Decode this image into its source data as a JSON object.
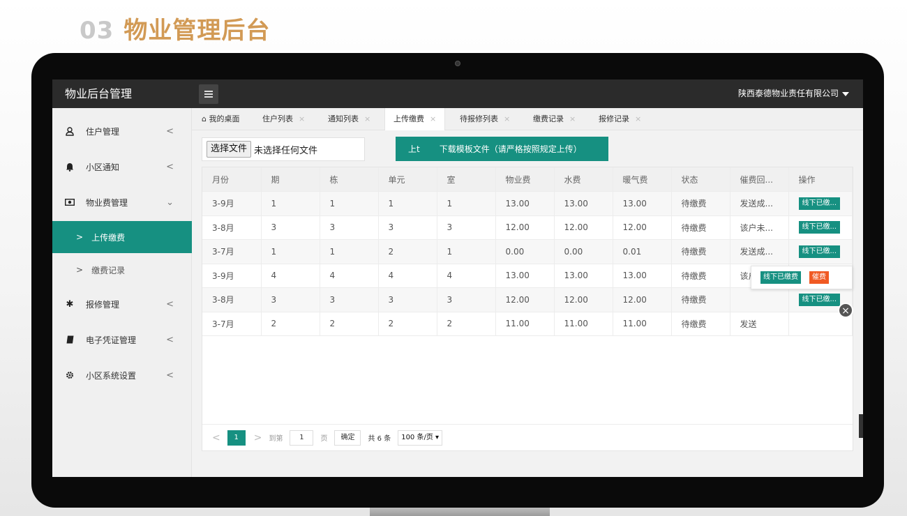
{
  "slide": {
    "number": "03",
    "title": "物业管理后台"
  },
  "app": {
    "brand": "物业后台管理",
    "company": "陕西泰德物业责任有限公司"
  },
  "sidebar": {
    "items": [
      {
        "label": "住户管理",
        "icon": "user-icon"
      },
      {
        "label": "小区通知",
        "icon": "bell-icon"
      },
      {
        "label": "物业费管理",
        "icon": "money-icon"
      },
      {
        "label": "报修管理",
        "icon": "wrench-icon"
      },
      {
        "label": "电子凭证管理",
        "icon": "book-icon"
      },
      {
        "label": "小区系统设置",
        "icon": "gear-icon"
      }
    ],
    "sub_items": [
      {
        "label": "上传缴费",
        "active": true
      },
      {
        "label": "缴费记录",
        "active": false
      }
    ]
  },
  "tabs": [
    {
      "label": "我的桌面"
    },
    {
      "label": "住户列表"
    },
    {
      "label": "通知列表"
    },
    {
      "label": "上传缴费"
    },
    {
      "label": "待报修列表"
    },
    {
      "label": "缴费记录"
    },
    {
      "label": "报修记录"
    }
  ],
  "upload": {
    "choose_file_label": "选择文件",
    "no_file_text": "未选择任何文件",
    "button_prefix": "上t",
    "button_label": "下载模板文件（请严格按照规定上传）"
  },
  "table": {
    "columns": [
      "月份",
      "期",
      "栋",
      "单元",
      "室",
      "物业费",
      "水费",
      "暖气费",
      "状态",
      "催费回...",
      "操作"
    ],
    "rows": [
      [
        "3-9月",
        "1",
        "1",
        "1",
        "1",
        "13.00",
        "13.00",
        "13.00",
        "待缴费",
        "发送成...",
        "线下已缴..."
      ],
      [
        "3-8月",
        "3",
        "3",
        "3",
        "3",
        "12.00",
        "12.00",
        "12.00",
        "待缴费",
        "该户未...",
        "线下已缴..."
      ],
      [
        "3-7月",
        "1",
        "1",
        "2",
        "1",
        "0.00",
        "0.00",
        "0.01",
        "待缴费",
        "发送成...",
        "线下已缴..."
      ],
      [
        "3-9月",
        "4",
        "4",
        "4",
        "4",
        "13.00",
        "13.00",
        "13.00",
        "待缴费",
        "该户未...",
        "线下已缴..."
      ],
      [
        "3-8月",
        "3",
        "3",
        "3",
        "3",
        "12.00",
        "12.00",
        "12.00",
        "待缴费",
        "",
        "线下已缴..."
      ],
      [
        "3-7月",
        "2",
        "2",
        "2",
        "2",
        "11.00",
        "11.00",
        "11.00",
        "待缴费",
        "发送",
        ""
      ]
    ]
  },
  "popup": {
    "paid_offline": "线下已缴费",
    "remind": "催费",
    "close": "×"
  },
  "pager": {
    "current_page": "1",
    "goto_label": "到第",
    "goto_value": "1",
    "page_unit": "页",
    "confirm": "确定",
    "total": "共 6 条",
    "page_size": "100 条/页"
  },
  "colors": {
    "accent": "#169081",
    "danger": "#f05a23",
    "title": "#d29a55",
    "topbar": "#2b2b2b"
  }
}
